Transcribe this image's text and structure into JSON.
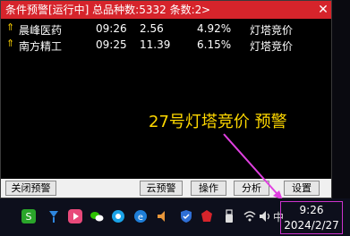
{
  "window": {
    "title": "条件预警[运行中] 总品种数:5332 条数:2",
    "expand_label": ">",
    "close_label": "✕"
  },
  "rows": [
    {
      "name": "晨峰医药",
      "time": "09:26",
      "price": "2.56",
      "pct": "4.92%",
      "signal": "灯塔竞价"
    },
    {
      "name": "南方精工",
      "time": "09:25",
      "price": "11.39",
      "pct": "6.15%",
      "signal": "灯塔竞价"
    }
  ],
  "annotation": "27号灯塔竞价 预警",
  "buttons": {
    "close_alert": "关闭预警",
    "cloud_alert": "云预警",
    "operate": "操作",
    "analyze": "分析",
    "settings": "设置"
  },
  "colors": {
    "titlebar": "#d6242b",
    "annotation": "#ffd800",
    "arrow": "#e040e0"
  },
  "taskbar": {
    "icons": [
      "s-app-icon",
      "pin-icon",
      "video-icon",
      "wechat-icon",
      "browser-icon",
      "speaker-icon",
      "shield-icon",
      "shield-red-icon",
      "usb-icon",
      "wifi-icon",
      "volume-icon",
      "ime-icon"
    ],
    "ime_label": "中"
  },
  "clock": {
    "time": "9:26",
    "date": "2024/2/27"
  }
}
